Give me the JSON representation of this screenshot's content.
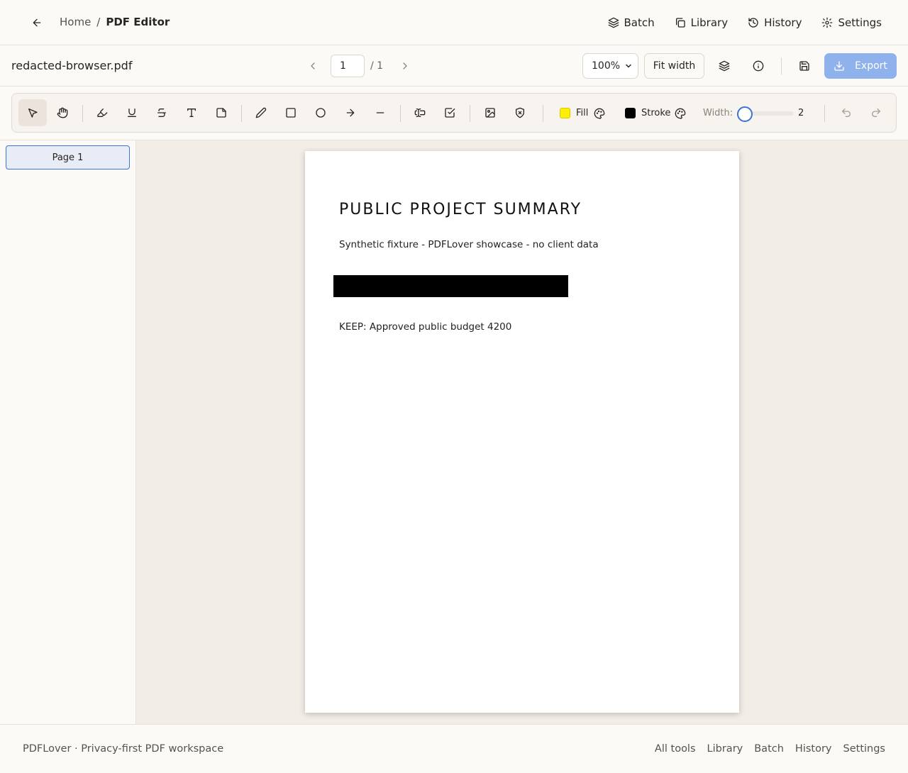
{
  "nav": {
    "breadcrumb": {
      "home": "Home",
      "separator": "/",
      "current": "PDF Editor"
    },
    "links": [
      {
        "label": "Batch",
        "icon": "layers-icon"
      },
      {
        "label": "Library",
        "icon": "copy-icon"
      },
      {
        "label": "History",
        "icon": "history-icon"
      },
      {
        "label": "Settings",
        "icon": "gear-icon"
      }
    ]
  },
  "filebar": {
    "filename": "redacted-browser.pdf",
    "page_current": "1",
    "page_total": "/ 1",
    "zoom": "100%",
    "fit_label": "Fit width",
    "export_label": "Export"
  },
  "toolbar": {
    "active_tool": "select",
    "fill_label": "Fill",
    "fill_color": "#ffee00",
    "stroke_label": "Stroke",
    "stroke_color": "#000000",
    "width_label": "Width:",
    "width_value": "2"
  },
  "sidebar": {
    "pages": [
      {
        "label": "Page 1"
      }
    ]
  },
  "document": {
    "title": "PUBLIC PROJECT SUMMARY",
    "subtitle": "Synthetic fixture - PDFLover showcase - no client data",
    "keep_line": "KEEP: Approved public budget 4200"
  },
  "footer": {
    "brand": "PDFLover · Privacy-first PDF workspace",
    "links": [
      "All tools",
      "Library",
      "Batch",
      "History",
      "Settings"
    ]
  },
  "colors": {
    "accent": "#3c73d6",
    "export_bg": "#8fb1ec",
    "canvas_bg": "#f3ede7"
  }
}
